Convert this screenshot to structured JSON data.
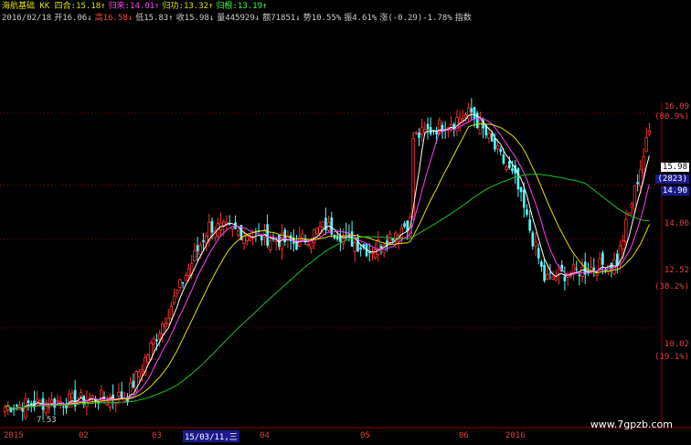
{
  "header": {
    "line1": [
      {
        "text": "海航基础 KK 四合:15.18↑",
        "color": "#e0e000"
      },
      {
        "text": "归来:14.01↑",
        "color": "#ff40ff"
      },
      {
        "text": "归功:13.32↑",
        "color": "#e0e000"
      },
      {
        "text": "归根:13.19↑",
        "color": "#40ff40"
      }
    ],
    "line2": [
      {
        "text": "2016/02/18",
        "color": "#cccccc"
      },
      {
        "text": "开16.06↓",
        "color": "#cccccc"
      },
      {
        "text": "高16.58↓",
        "color": "#ff4040"
      },
      {
        "text": "低15.83↑",
        "color": "#cccccc"
      },
      {
        "text": "收15.98↓",
        "color": "#cccccc"
      },
      {
        "text": "量445929↓",
        "color": "#cccccc"
      },
      {
        "text": "额71851↓",
        "color": "#cccccc"
      },
      {
        "text": "势10.55%",
        "color": "#cccccc"
      },
      {
        "text": "振4.61%",
        "color": "#cccccc"
      },
      {
        "text": "涨(-0.29)-1.78%",
        "color": "#cccccc"
      },
      {
        "text": "指数",
        "color": "#cccccc"
      }
    ]
  },
  "y_axis": {
    "ticks": [
      "16.09",
      "14.06",
      "12.52",
      "10.02"
    ],
    "pct": [
      "(80.9%)",
      "(38.2%)",
      "(19.1%)"
    ],
    "price_tag": "15.98",
    "vol_tag": "(2823)",
    "tag_1490": "14.90"
  },
  "x_axis": {
    "labels": [
      "2015",
      "02",
      "03",
      "04",
      "05",
      "06",
      "2016"
    ],
    "cursor_date": "15/03/11,三"
  },
  "low_label": "7.53",
  "watermark": "www.7gpzb.com",
  "colors": {
    "up": "#ff3030",
    "down": "#54fcfc",
    "ma1": "#ffffff",
    "ma2": "#ff40ff",
    "ma3": "#e0e000",
    "ma4": "#20c020",
    "grid": "#8a0000"
  },
  "chart_data": {
    "type": "candlestick",
    "ylim": [
      7.2,
      16.4
    ],
    "x_labels": [
      "2015",
      "02",
      "03",
      "04",
      "05",
      "06",
      "2016"
    ],
    "segments": [
      {
        "from": 0,
        "to": 42,
        "start": 7.8,
        "end": 8.1
      },
      {
        "from": 42,
        "to": 70,
        "start": 8.1,
        "end": 12.9
      },
      {
        "from": 70,
        "to": 100,
        "start": 12.9,
        "end": 12.4
      },
      {
        "from": 100,
        "to": 110,
        "start": 12.4,
        "end": 12.9
      },
      {
        "from": 110,
        "to": 125,
        "start": 12.9,
        "end": 12.2
      },
      {
        "from": 125,
        "to": 140,
        "start": 12.2,
        "end": 13.1
      },
      {
        "from": 140,
        "to": 160,
        "start": 15.4,
        "end": 16.1
      },
      {
        "from": 160,
        "to": 175,
        "start": 16.1,
        "end": 14.2
      },
      {
        "from": 175,
        "to": 185,
        "start": 14.2,
        "end": 11.4
      },
      {
        "from": 185,
        "to": 210,
        "start": 11.4,
        "end": 11.9
      },
      {
        "from": 210,
        "to": 222,
        "start": 11.9,
        "end": 15.9
      }
    ],
    "count": 222,
    "series": [
      {
        "name": "四合",
        "value": 15.18
      },
      {
        "name": "归来",
        "value": 14.01
      },
      {
        "name": "归功",
        "value": 13.32
      },
      {
        "name": "归根",
        "value": 13.19
      }
    ]
  }
}
